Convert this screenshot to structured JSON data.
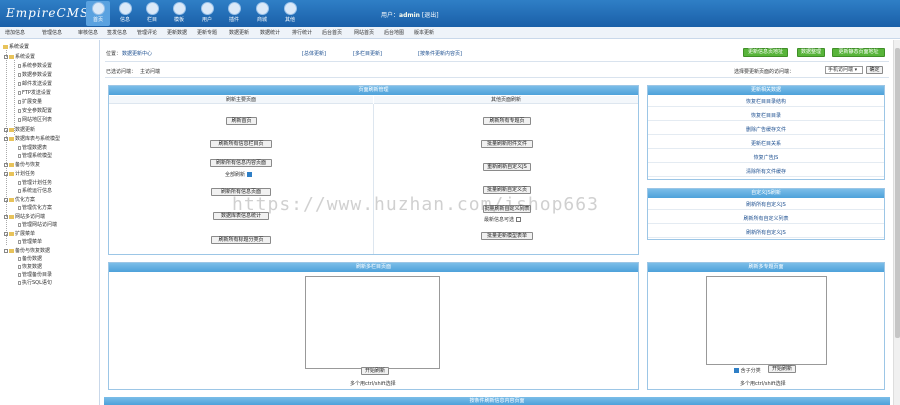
{
  "header": {
    "logo": "EmpireCMS",
    "nav": [
      {
        "label": "首页",
        "icon": "home-icon"
      },
      {
        "label": "信息",
        "icon": "info-icon"
      },
      {
        "label": "栏目",
        "icon": "folder-icon"
      },
      {
        "label": "模板",
        "icon": "template-icon"
      },
      {
        "label": "用户",
        "icon": "user-icon"
      },
      {
        "label": "插件",
        "icon": "plugin-icon"
      },
      {
        "label": "商城",
        "icon": "shop-icon"
      },
      {
        "label": "其他",
        "icon": "other-icon"
      }
    ],
    "user_prefix": "用户：",
    "user_name": "admin",
    "logout": "[退出]"
  },
  "submenu": [
    "增加信息",
    "管理信息",
    "审核信息",
    "签发信息",
    "管理评论",
    "更新数据",
    "更新专题",
    "数据更新",
    "数据统计",
    "排行统计",
    "后台首页",
    "网站首页",
    "后台地图",
    "版本更新"
  ],
  "sidebar": {
    "root": "系统设置",
    "groups": [
      {
        "label": "系统设置",
        "items": [
          "系统参数设置",
          "数据参数设置",
          "邮件发送设置",
          "FTP发送设置",
          "扩展变量",
          "安全参数配置",
          "网站地区列表"
        ]
      },
      {
        "label": "数据更新",
        "items": []
      },
      {
        "label": "数据库表与系统模型",
        "items": [
          "管理数据表",
          "管理系统模型"
        ]
      },
      {
        "label": "备份与恢复",
        "items": []
      },
      {
        "label": "计划任务",
        "items": [
          "管理计划任务",
          "系统运行信息"
        ]
      },
      {
        "label": "优化方案",
        "items": [
          "管理优化方案"
        ]
      },
      {
        "label": "网站多访问端",
        "items": [
          "管理网站访问端"
        ]
      },
      {
        "label": "扩展菜单",
        "items": [
          "管理菜单"
        ]
      },
      {
        "label": "备份与恢复数据",
        "items": [
          "备份数据",
          "恢复数据",
          "管理备份目录",
          "执行SQL语句"
        ]
      }
    ]
  },
  "content": {
    "position_label": "位置：",
    "position_link": "数据更新中心",
    "tabs": [
      "[总体更新]",
      "[多栏目更新]",
      "[按条件更新内容页]"
    ],
    "top_buttons": [
      "更新信息页地址",
      "数据整理",
      "更新静态页面地址"
    ],
    "terminal_label": "已选访问端：",
    "terminal_value": "主访问端",
    "terminal_select_label": "选择要更新页面的访问端：",
    "terminal_select_value": "手机访问端",
    "terminal_confirm": "确定",
    "main_panel": {
      "title": "页面刷新管理",
      "left_title": "刷新主要页面",
      "right_title": "其他页面刷新",
      "left_buttons": [
        "刷新首页",
        "刷新所有信息栏目页",
        "刷新所有信息内容页面",
        "刷新所有信息页面",
        "数据库表信息统计",
        "刷新所有标题分类页"
      ],
      "left_check_label": "全部刷新",
      "right_buttons": [
        "刷新所有专题页",
        "批量刷新附件文件",
        "重新刷新自定义JS",
        "批量刷新自定义页",
        "批量刷新自定义列表",
        "批量更新模型表单"
      ],
      "right_check_label": "最新信息可选"
    },
    "side_panel": {
      "title": "更新相关数据",
      "items": [
        "恢复栏目目录结构",
        "恢复栏目目录",
        "删除广告缓存文件",
        "更新栏目关系",
        "恢复广告JS",
        "清除所有文件缓存"
      ]
    },
    "js_panel": {
      "title": "自定义JS刷新",
      "items": [
        "刷新所有自定义JS",
        "刷新所有自定义列表",
        "刷新所有自定义JS"
      ]
    },
    "col_panel": {
      "title": "刷新多栏目页面",
      "button": "开始刷新",
      "hint": "多个用ctrl/shift选择"
    },
    "topic_panel": {
      "title": "刷新多专题页面",
      "check_label": "含子分类",
      "button": "开始刷新",
      "hint": "多个用ctrl/shift选择"
    },
    "bottom_title": "按条件刷新信息内容页面"
  },
  "watermark": "https://www.huzhan.com/ishop663"
}
